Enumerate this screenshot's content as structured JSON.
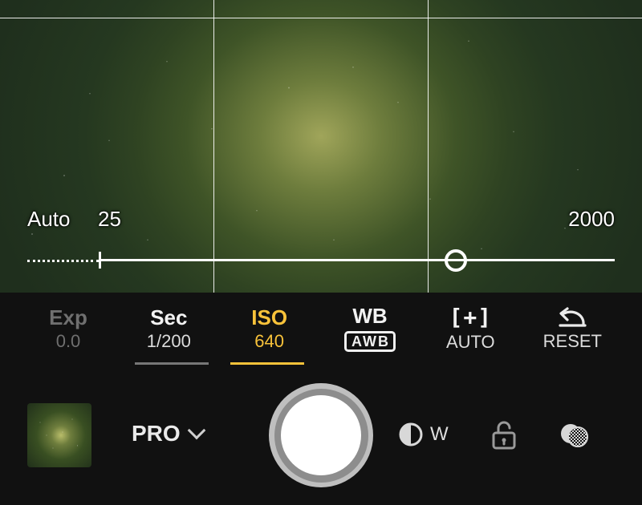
{
  "iso_slider": {
    "auto_label": "Auto",
    "min_label": "25",
    "max_label": "2000",
    "min": 25,
    "max": 2000,
    "value": 640,
    "thumb_pct": 73
  },
  "tabs": {
    "exp": {
      "title": "Exp",
      "value": "0.0"
    },
    "sec": {
      "title": "Sec",
      "value": "1/200"
    },
    "iso": {
      "title": "ISO",
      "value": "640"
    },
    "wb": {
      "title": "WB",
      "value": "AWB"
    },
    "focus": {
      "title_icon": "[+]",
      "value": "AUTO"
    },
    "reset": {
      "value": "RESET"
    }
  },
  "bottom": {
    "mode_label": "PRO",
    "lens_label": "W"
  },
  "colors": {
    "accent": "#f8c23a"
  }
}
